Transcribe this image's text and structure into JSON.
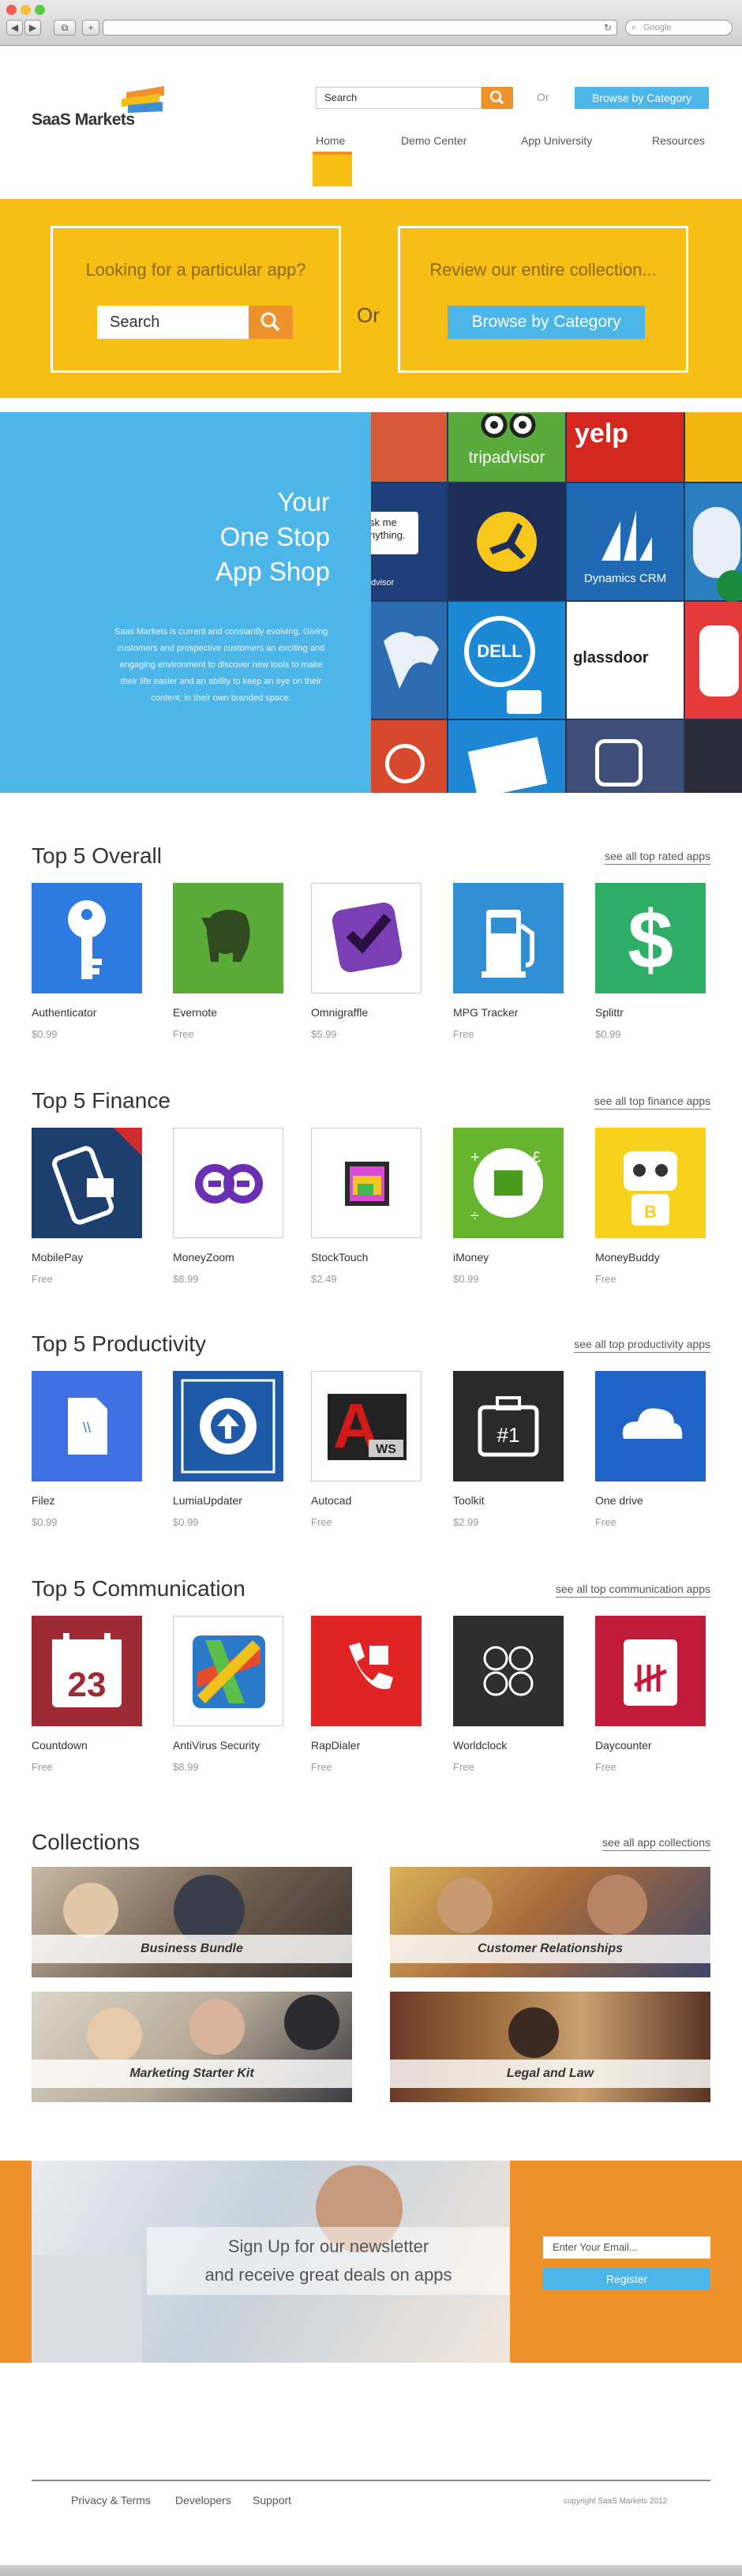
{
  "browser": {
    "search_placeholder": "Google"
  },
  "header": {
    "logo": "SaaS Markets",
    "search_placeholder": "Search",
    "or": "Or",
    "browse_button": "Browse by Category",
    "nav": [
      "Home",
      "Demo Center",
      "App University",
      "Resources"
    ]
  },
  "hero": {
    "left_heading": "Looking for a particular app?",
    "search_placeholder": "Search",
    "or": "Or",
    "right_heading": "Review our entire collection...",
    "browse_button": "Browse by Category"
  },
  "banner": {
    "title_lines": [
      "Your",
      "One Stop",
      "App Shop"
    ],
    "description": "Saas Markets is current and constantly evolving. Giving customers and prospective customers an exciting and engaging environment to discover new tools to make their life easier and an ability to keep an eye on their content, in their own branded space.",
    "mosaic_labels": {
      "tripadvisor": "tripadvisor",
      "yelp": "yelp",
      "dynamics": "Dynamics CRM",
      "dell": "DELL",
      "glassdoor": "glassdoor",
      "askme": "sk me nything.",
      "advisor": "dvisor"
    }
  },
  "sections": [
    {
      "title": "Top 5 Overall",
      "see_all": "see all top rated apps",
      "apps": [
        {
          "name": "Authenticator",
          "price": "$0.99",
          "bg": "#2e7be0",
          "icon": "key-icon"
        },
        {
          "name": "Evernote",
          "price": "Free",
          "bg": "#5bab38",
          "icon": "elephant-icon"
        },
        {
          "name": "Omnigraffle",
          "price": "$5.99",
          "bg": "#ffffff",
          "icon": "checkmark-icon"
        },
        {
          "name": "MPG Tracker",
          "price": "Free",
          "bg": "#2f8ed4",
          "icon": "gas-pump-icon"
        },
        {
          "name": "Splittr",
          "price": "$0.99",
          "bg": "#2fae67",
          "icon": "dollar-icon"
        }
      ]
    },
    {
      "title": "Top 5 Finance",
      "see_all": "see all top finance apps",
      "apps": [
        {
          "name": "MobilePay",
          "price": "Free",
          "bg": "#1d3f6e",
          "icon": "phone-pay-icon"
        },
        {
          "name": "MoneyZoom",
          "price": "$8.99",
          "bg": "#ffffff",
          "icon": "moneyzoom-icon"
        },
        {
          "name": "StockTouch",
          "price": "$2.49",
          "bg": "#ffffff",
          "icon": "stocktouch-icon"
        },
        {
          "name": "iMoney",
          "price": "$0.99",
          "bg": "#67b52e",
          "icon": "currency-icon"
        },
        {
          "name": "MoneyBuddy",
          "price": "Free",
          "bg": "#f7d11b",
          "icon": "robot-icon"
        }
      ]
    },
    {
      "title": "Top 5 Productivity",
      "see_all": "see all top productivity apps",
      "apps": [
        {
          "name": "Filez",
          "price": "$0.99",
          "bg": "#3f6fe0",
          "icon": "file-icon"
        },
        {
          "name": "LumiaUpdater",
          "price": "$0.99",
          "bg": "#1e5aa8",
          "icon": "gear-upload-icon"
        },
        {
          "name": "Autocad",
          "price": "Free",
          "bg": "#ffffff",
          "icon": "autocad-icon"
        },
        {
          "name": "Toolkit",
          "price": "$2.99",
          "bg": "#2b2b2b",
          "icon": "toolbox-icon"
        },
        {
          "name": "One drive",
          "price": "Free",
          "bg": "#1e63c5",
          "icon": "cloud-icon"
        }
      ]
    },
    {
      "title": "Top 5 Communication",
      "see_all": "see all top communication apps",
      "apps": [
        {
          "name": "Countdown",
          "price": "Free",
          "bg": "#9e2a34",
          "icon": "calendar-icon"
        },
        {
          "name": "AntiVirus Security",
          "price": "$8.99",
          "bg": "#ffffff",
          "icon": "avg-icon"
        },
        {
          "name": "RapDialer",
          "price": "Free",
          "bg": "#e02424",
          "icon": "phone-icon"
        },
        {
          "name": "Worldclock",
          "price": "Free",
          "bg": "#2e2e2e",
          "icon": "clock-icon"
        },
        {
          "name": "Daycounter",
          "price": "Free",
          "bg": "#c11b3a",
          "icon": "notepad-icon"
        }
      ]
    }
  ],
  "collections": {
    "title": "Collections",
    "see_all": "see all app collections",
    "items": [
      "Business Bundle",
      "Customer Relationships",
      "Marketing Starter Kit",
      "Legal and Law"
    ]
  },
  "newsletter": {
    "line1": "Sign Up for our newsletter",
    "line2": "and receive great deals on apps",
    "email_placeholder": "Enter Your Email...",
    "register": "Register"
  },
  "footer": {
    "links": [
      "Privacy & Terms",
      "Developers",
      "Support"
    ],
    "copyright": "copyright SaaS Markets 2012"
  },
  "colors": {
    "accent_yellow": "#f7bf16",
    "accent_orange": "#f0922c",
    "accent_blue": "#4db6e8"
  }
}
